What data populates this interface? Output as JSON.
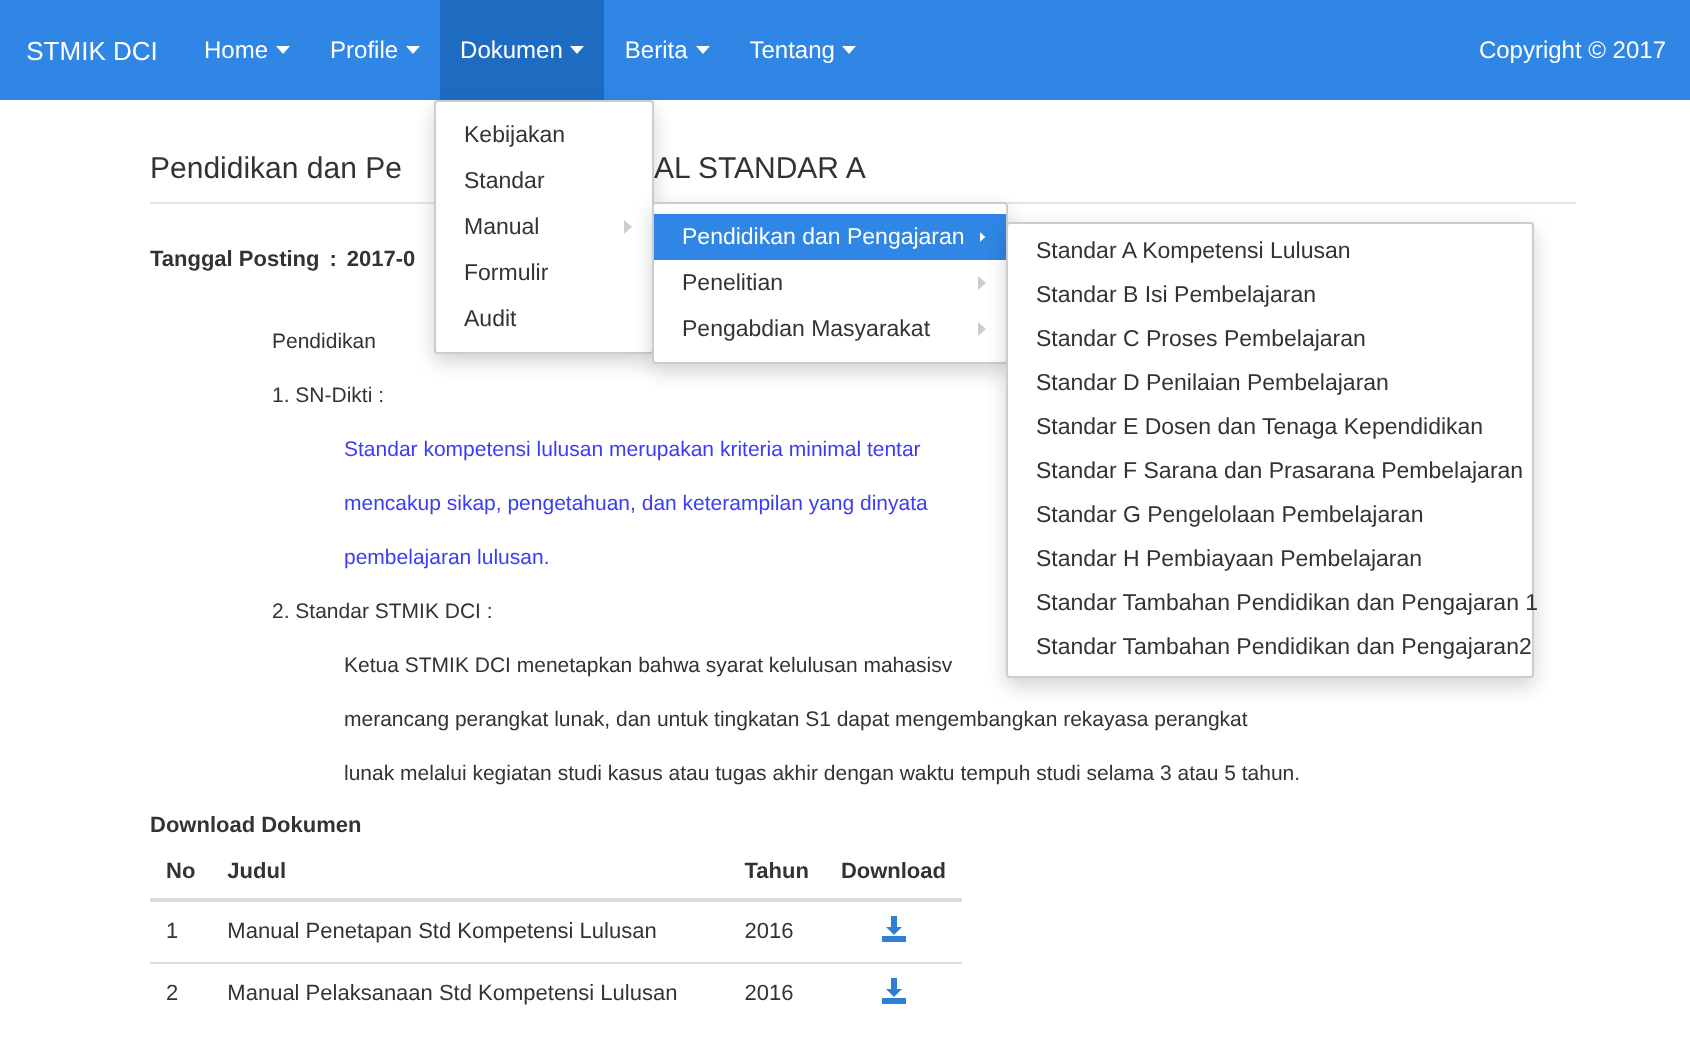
{
  "navbar": {
    "brand": "STMIK DCI",
    "copyright": "Copyright © 2017",
    "items": [
      {
        "label": "Home",
        "selected": false
      },
      {
        "label": "Profile",
        "selected": false
      },
      {
        "label": "Dokumen",
        "selected": true
      },
      {
        "label": "Berita",
        "selected": false
      },
      {
        "label": "Tentang",
        "selected": false
      }
    ]
  },
  "dropdown": {
    "items": [
      {
        "label": "Kebijakan",
        "submenu": false,
        "selected": false
      },
      {
        "label": "Standar",
        "submenu": false,
        "selected": false
      },
      {
        "label": "Manual",
        "submenu": true,
        "selected": false
      },
      {
        "label": "Formulir",
        "submenu": false,
        "selected": false
      },
      {
        "label": "Audit",
        "submenu": false,
        "selected": false
      }
    ]
  },
  "submenu": {
    "items": [
      {
        "label": "Pendidikan dan Pengajaran",
        "submenu": true,
        "selected": true
      },
      {
        "label": "Penelitian",
        "submenu": true,
        "selected": false
      },
      {
        "label": "Pengabdian Masyarakat",
        "submenu": true,
        "selected": false
      }
    ]
  },
  "submenu_2": {
    "items": [
      "Standar A Kompetensi Lulusan",
      "Standar B Isi Pembelajaran",
      "Standar C Proses Pembelajaran",
      "Standar D Penilaian Pembelajaran",
      "Standar E Dosen dan Tenaga Kependidikan",
      "Standar F Sarana dan Prasarana Pembelajaran",
      "Standar G Pengelolaan Pembelajaran",
      "Standar H Pembiayaan Pembelajaran",
      "Standar Tambahan Pendidikan dan Pengajaran 1",
      "Standar Tambahan Pendidikan dan Pengajaran2"
    ]
  },
  "content": {
    "title_parts": [
      "Pendidikan dan Pe",
      "AL STANDAR A"
    ],
    "posting": {
      "label": "Tanggal Posting",
      "separator": ":",
      "date": "2017-0"
    },
    "lines": [
      {
        "kind": "plain",
        "text": "Pendidikan"
      },
      {
        "kind": "plain",
        "text": "1. SN-Dikti :"
      },
      {
        "kind": "link",
        "text": "Standar kompetensi lulusan merupakan kriteria minimal tentar"
      },
      {
        "kind": "link",
        "text": "mencakup sikap, pengetahuan, dan keterampilan yang dinyata"
      },
      {
        "kind": "link",
        "text": "pembelajaran lulusan."
      },
      {
        "kind": "plain",
        "text": "2. Standar STMIK DCI :"
      },
      {
        "kind": "indent",
        "text": "Ketua STMIK DCI menetapkan bahwa syarat kelulusan mahasisv"
      },
      {
        "kind": "indent",
        "text": "merancang perangkat lunak, dan untuk tingkatan S1 dapat mengembangkan rekayasa perangkat"
      },
      {
        "kind": "indent",
        "text": "lunak melalui kegiatan studi kasus atau tugas akhir dengan waktu tempuh studi selama 3 atau 5 tahun."
      }
    ]
  },
  "downloads": {
    "heading": "Download Dokumen",
    "columns": [
      "No",
      "Judul",
      "Tahun",
      "Download"
    ],
    "rows": [
      {
        "no": "1",
        "judul": "Manual Penetapan Std Kompetensi Lulusan",
        "tahun": "2016"
      },
      {
        "no": "2",
        "judul": "Manual Pelaksanaan Std Kompetensi Lulusan",
        "tahun": "2016"
      }
    ]
  }
}
